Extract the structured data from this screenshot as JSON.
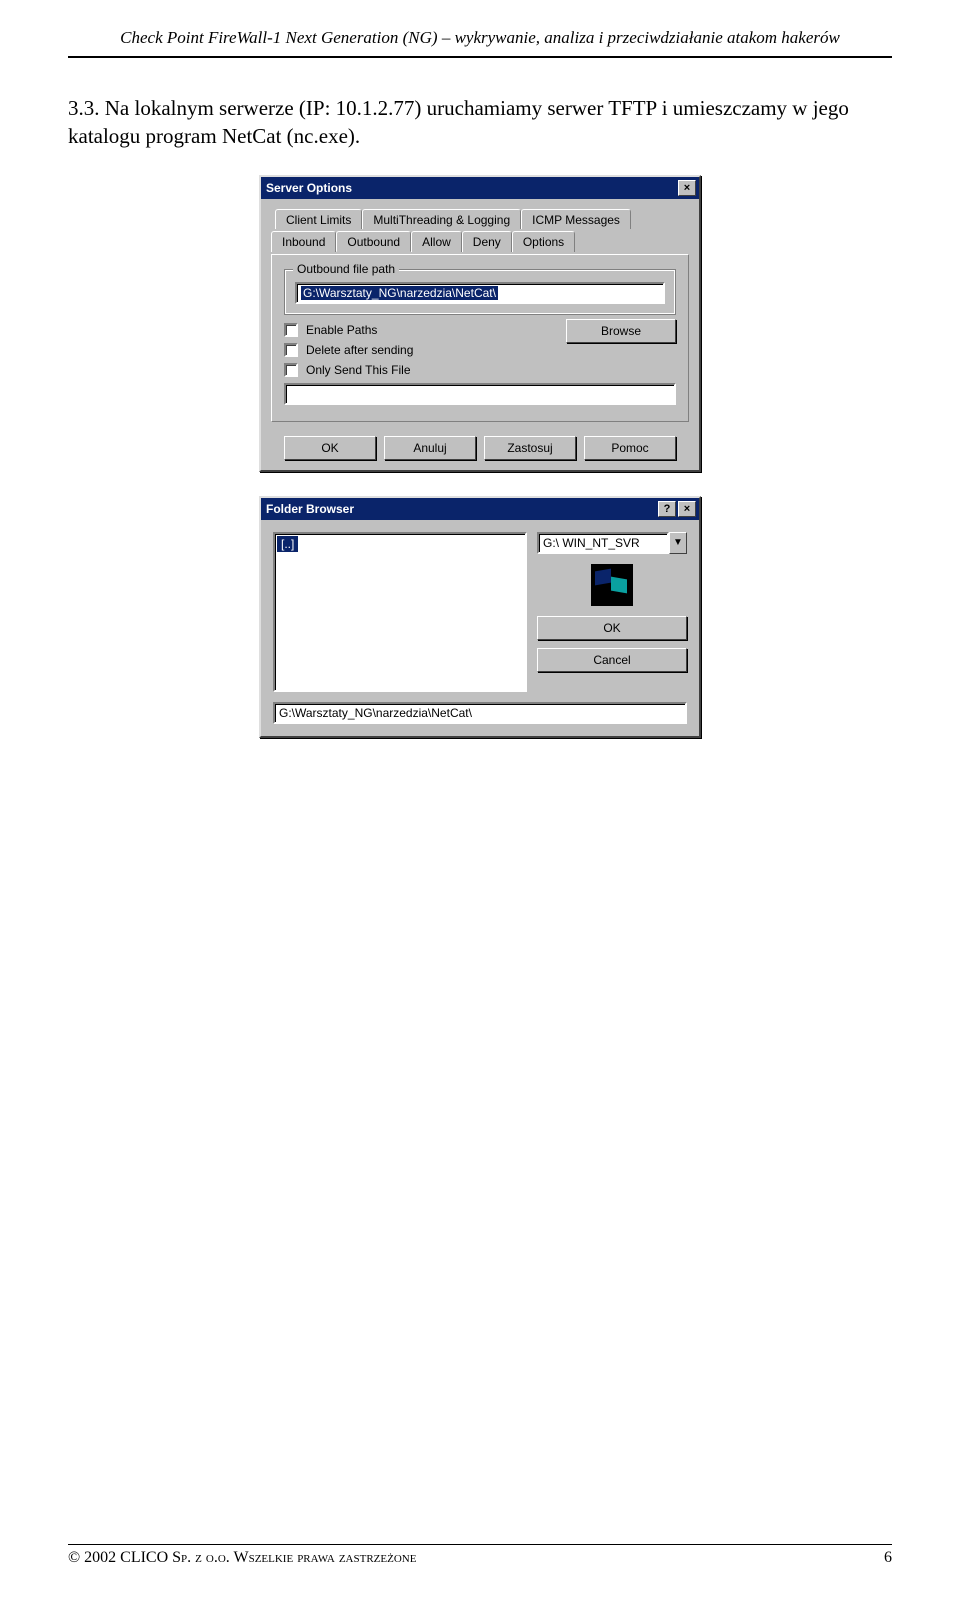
{
  "doc": {
    "header": "Check Point FireWall-1 Next Generation (NG) – wykrywanie, analiza i przeciwdziałanie atakom hakerów",
    "paragraph": "3.3. Na lokalnym serwerze (IP: 10.1.2.77) uruchamiamy serwer TFTP i umieszczamy w jego katalogu program NetCat (nc.exe).",
    "copyright": "© 2002 CLICO Sp. z o.o. Wszelkie prawa zastrzeżone",
    "page_number": "6"
  },
  "server_options": {
    "title": "Server Options",
    "tabs_back": [
      "Client Limits",
      "MultiThreading & Logging",
      "ICMP Messages"
    ],
    "tabs_front": [
      "Inbound",
      "Outbound",
      "Allow",
      "Deny",
      "Options"
    ],
    "active_tab": "Outbound",
    "group_label": "Outbound file path",
    "path_value": "G:\\Warsztaty_NG\\narzedzia\\NetCat\\",
    "chk_enable_paths": "Enable Paths",
    "chk_delete_after": "Delete after sending",
    "chk_only_send": "Only Send This File",
    "only_send_value": "",
    "browse_label": "Browse",
    "buttons": {
      "ok": "OK",
      "cancel": "Anuluj",
      "apply": "Zastosuj",
      "help": "Pomoc"
    }
  },
  "folder_browser": {
    "title": "Folder Browser",
    "list_item": "[..]",
    "drive_value": "G:\\ WIN_NT_SVR",
    "ok": "OK",
    "cancel": "Cancel",
    "path_value": "G:\\Warsztaty_NG\\narzedzia\\NetCat\\"
  }
}
